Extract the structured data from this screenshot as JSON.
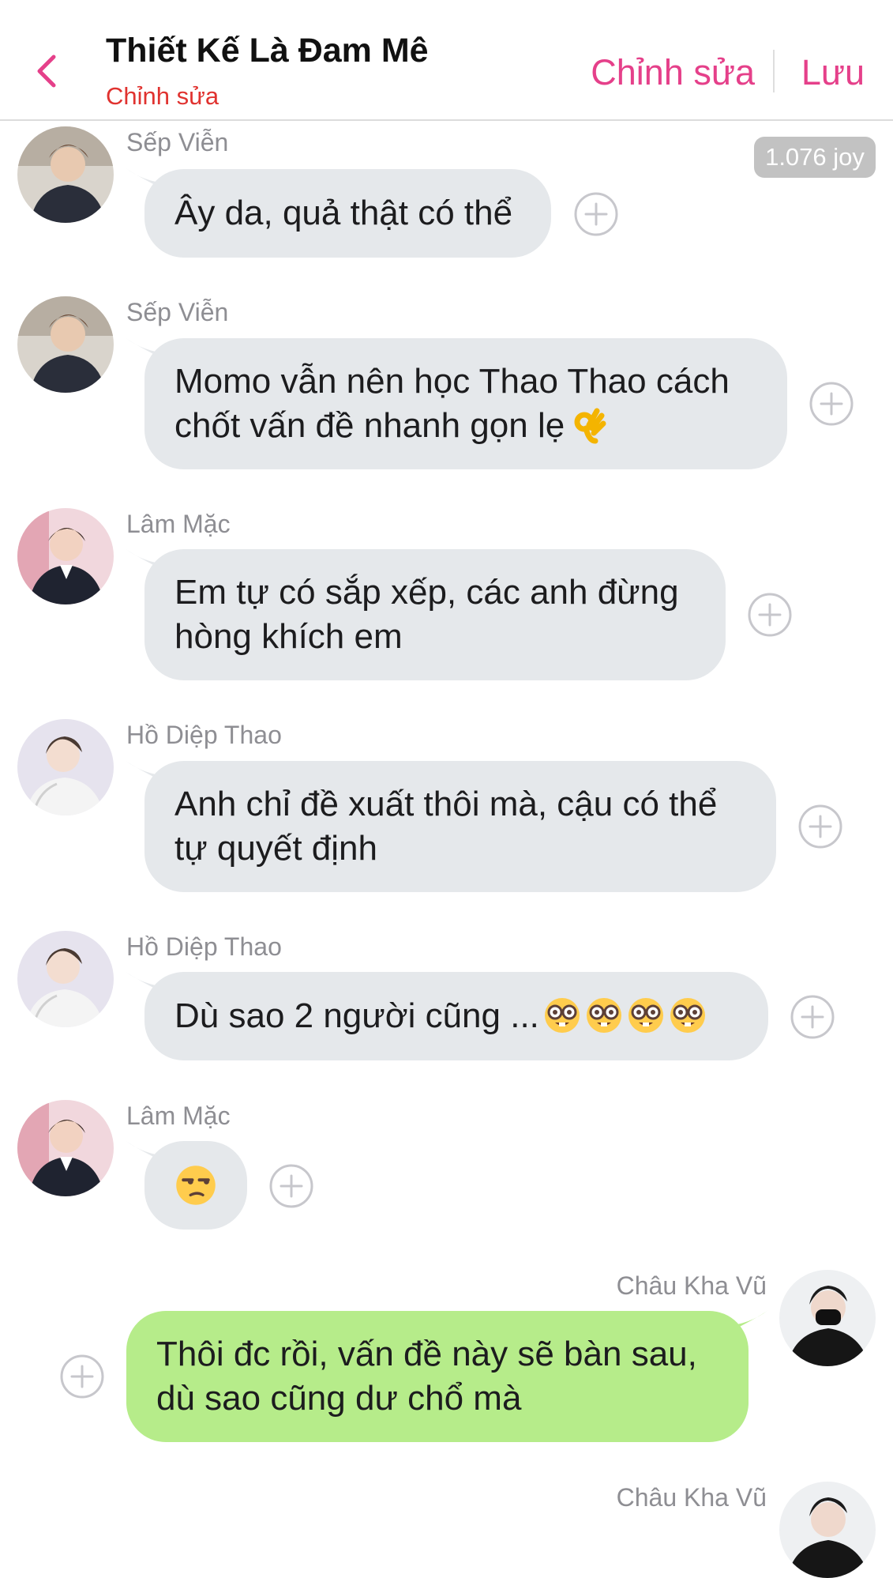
{
  "header": {
    "title": "Thiết Kế Là Đam Mê",
    "subtitle": "Chỉnh sửa",
    "edit_label": "Chỉnh sửa",
    "save_label": "Lưu",
    "back_icon": "chevron-left-icon",
    "accent_color": "#e5408a",
    "subtitle_color": "#e0322f"
  },
  "joy_badge": "1.076 joy",
  "messages": [
    {
      "sender": "Sếp Viễn",
      "text": "Ây da, quả thật có thể",
      "side": "incoming"
    },
    {
      "sender": "Sếp Viễn",
      "text": "Momo vẫn nên học Thao Thao cách\nchốt vấn đề nhanh gọn lẹ",
      "emoji": "ok-hand-emoji",
      "side": "incoming"
    },
    {
      "sender": "Lâm Mặc",
      "text": "Em tự có sắp xếp, các anh đừng\nhòng khích em",
      "side": "incoming"
    },
    {
      "sender": "Hồ Diệp Thao",
      "text": "Anh chỉ đề xuất thôi mà, cậu có thể\ntự quyết định",
      "side": "incoming"
    },
    {
      "sender": "Hồ Diệp Thao",
      "text": "Dù sao 2 người cũng ...",
      "emoji": "nerd-face-emoji x4",
      "side": "incoming"
    },
    {
      "sender": "Lâm Mặc",
      "text": "",
      "emoji": "unamused-face-emoji",
      "side": "incoming"
    },
    {
      "sender": "Châu Kha Vũ",
      "text": "Thôi đc rồi, vấn đề này sẽ bàn sau,\ndù sao cũng dư chổ mà",
      "side": "outgoing"
    },
    {
      "sender": "Châu Kha Vũ",
      "text": "",
      "side": "outgoing"
    }
  ],
  "colors": {
    "incoming_bubble": "#e5e8eb",
    "outgoing_bubble": "#b6ec8a",
    "sender_name": "#8e8e93",
    "joy_badge_bg": "#c2c2c2"
  }
}
